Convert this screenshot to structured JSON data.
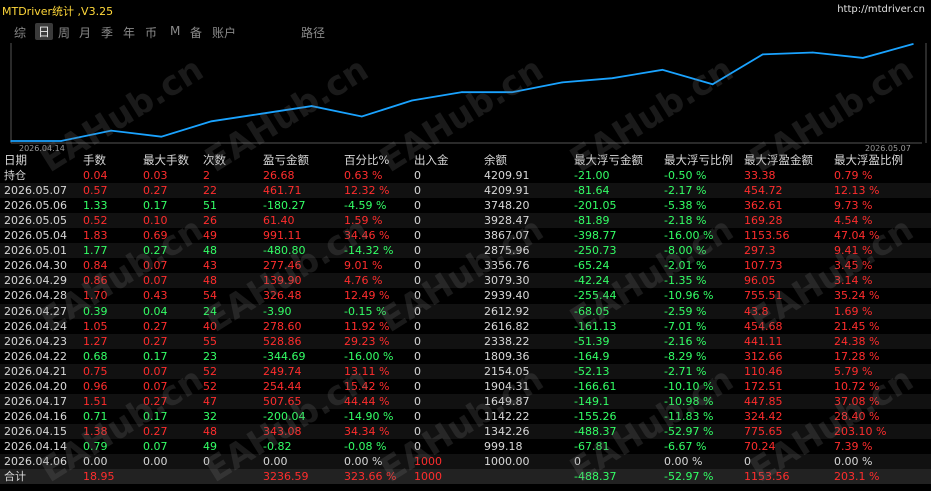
{
  "header": {
    "title": "MTDriver统计 ,V3.25",
    "url": "http://mtdriver.cn"
  },
  "tabs": [
    {
      "label": "综",
      "active": false
    },
    {
      "label": "日",
      "active": true
    },
    {
      "label": "周",
      "active": false
    },
    {
      "label": "月",
      "active": false
    },
    {
      "label": "季",
      "active": false
    },
    {
      "label": "年",
      "active": false
    },
    {
      "label": "币",
      "active": false
    },
    {
      "label": "M",
      "active": false
    },
    {
      "label": "备",
      "active": false
    },
    {
      "label": "账户",
      "active": false
    },
    {
      "label": "路径",
      "active": false
    }
  ],
  "chart_data": {
    "type": "line",
    "x_start_label": "2026.04.14",
    "x_end_label": "2026.05.07",
    "color": "#1aa3ff",
    "x": [
      "2026.04.06",
      "2026.04.14",
      "2026.04.15",
      "2026.04.16",
      "2026.04.17",
      "2026.04.20",
      "2026.04.21",
      "2026.04.22",
      "2026.04.23",
      "2026.04.24",
      "2026.04.27",
      "2026.04.28",
      "2026.04.29",
      "2026.04.30",
      "2026.05.01",
      "2026.05.04",
      "2026.05.05",
      "2026.05.06",
      "2026.05.07"
    ],
    "values": [
      1000.0,
      999.18,
      1342.26,
      1142.22,
      1649.87,
      1904.31,
      2154.05,
      1809.36,
      2338.22,
      2616.82,
      2612.92,
      2939.4,
      3079.3,
      3356.76,
      2875.96,
      3867.07,
      3928.47,
      3748.2,
      4209.91
    ]
  },
  "table": {
    "headers": [
      "日期",
      "手数",
      "最大手数",
      "次数",
      "盈亏金额",
      "百分比%",
      "出入金",
      "余额",
      "最大浮亏金额",
      "最大浮亏比例",
      "最大浮盈金额",
      "最大浮盈比例"
    ],
    "rows": [
      {
        "c": [
          "持仓",
          "0.04",
          "0.03",
          "2",
          "26.68",
          "0.63 %",
          "0",
          "4209.91",
          "-21.00",
          "-0.50 %",
          "33.38",
          "0.79 %"
        ],
        "k": [
          "w",
          "r",
          "r",
          "r",
          "r",
          "r",
          "w",
          "w",
          "g",
          "g",
          "r",
          "r"
        ]
      },
      {
        "c": [
          "2026.05.07",
          "0.57",
          "0.27",
          "22",
          "461.71",
          "12.32 %",
          "0",
          "4209.91",
          "-81.64",
          "-2.17 %",
          "454.72",
          "12.13 %"
        ],
        "k": [
          "w",
          "r",
          "r",
          "r",
          "r",
          "r",
          "w",
          "w",
          "g",
          "g",
          "r",
          "r"
        ]
      },
      {
        "c": [
          "2026.05.06",
          "1.33",
          "0.17",
          "51",
          "-180.27",
          "-4.59 %",
          "0",
          "3748.20",
          "-201.05",
          "-5.38 %",
          "362.61",
          "9.73 %"
        ],
        "k": [
          "w",
          "g",
          "g",
          "g",
          "g",
          "g",
          "w",
          "w",
          "g",
          "g",
          "r",
          "r"
        ]
      },
      {
        "c": [
          "2026.05.05",
          "0.52",
          "0.10",
          "26",
          "61.40",
          "1.59 %",
          "0",
          "3928.47",
          "-81.89",
          "-2.18 %",
          "169.28",
          "4.54 %"
        ],
        "k": [
          "w",
          "r",
          "r",
          "r",
          "r",
          "r",
          "w",
          "w",
          "g",
          "g",
          "r",
          "r"
        ]
      },
      {
        "c": [
          "2026.05.04",
          "1.83",
          "0.69",
          "49",
          "991.11",
          "34.46 %",
          "0",
          "3867.07",
          "-398.77",
          "-16.00 %",
          "1153.56",
          "47.04 %"
        ],
        "k": [
          "w",
          "r",
          "r",
          "r",
          "r",
          "r",
          "w",
          "w",
          "g",
          "g",
          "r",
          "r"
        ]
      },
      {
        "c": [
          "2026.05.01",
          "1.77",
          "0.27",
          "48",
          "-480.80",
          "-14.32 %",
          "0",
          "2875.96",
          "-250.73",
          "-8.00 %",
          "297.3",
          "9.41 %"
        ],
        "k": [
          "w",
          "g",
          "g",
          "g",
          "g",
          "g",
          "w",
          "w",
          "g",
          "g",
          "r",
          "r"
        ]
      },
      {
        "c": [
          "2026.04.30",
          "0.84",
          "0.07",
          "43",
          "277.46",
          "9.01 %",
          "0",
          "3356.76",
          "-65.24",
          "-2.01 %",
          "107.73",
          "3.45 %"
        ],
        "k": [
          "w",
          "r",
          "r",
          "r",
          "r",
          "r",
          "w",
          "w",
          "g",
          "g",
          "r",
          "r"
        ]
      },
      {
        "c": [
          "2026.04.29",
          "0.86",
          "0.07",
          "48",
          "139.90",
          "4.76 %",
          "0",
          "3079.30",
          "-42.24",
          "-1.35 %",
          "96.05",
          "3.14 %"
        ],
        "k": [
          "w",
          "r",
          "r",
          "r",
          "r",
          "r",
          "w",
          "w",
          "g",
          "g",
          "r",
          "r"
        ]
      },
      {
        "c": [
          "2026.04.28",
          "1.70",
          "0.43",
          "54",
          "326.48",
          "12.49 %",
          "0",
          "2939.40",
          "-255.44",
          "-10.96 %",
          "755.51",
          "35.24 %"
        ],
        "k": [
          "w",
          "r",
          "r",
          "r",
          "r",
          "r",
          "w",
          "w",
          "g",
          "g",
          "r",
          "r"
        ]
      },
      {
        "c": [
          "2026.04.27",
          "0.39",
          "0.04",
          "24",
          "-3.90",
          "-0.15 %",
          "0",
          "2612.92",
          "-68.05",
          "-2.59 %",
          "43.8",
          "1.69 %"
        ],
        "k": [
          "w",
          "g",
          "g",
          "g",
          "g",
          "g",
          "w",
          "w",
          "g",
          "g",
          "r",
          "r"
        ]
      },
      {
        "c": [
          "2026.04.24",
          "1.05",
          "0.27",
          "40",
          "278.60",
          "11.92 %",
          "0",
          "2616.82",
          "-161.13",
          "-7.01 %",
          "454.68",
          "21.45 %"
        ],
        "k": [
          "w",
          "r",
          "r",
          "r",
          "r",
          "r",
          "w",
          "w",
          "g",
          "g",
          "r",
          "r"
        ]
      },
      {
        "c": [
          "2026.04.23",
          "1.27",
          "0.27",
          "55",
          "528.86",
          "29.23 %",
          "0",
          "2338.22",
          "-51.39",
          "-2.16 %",
          "441.11",
          "24.38 %"
        ],
        "k": [
          "w",
          "r",
          "r",
          "r",
          "r",
          "r",
          "w",
          "w",
          "g",
          "g",
          "r",
          "r"
        ]
      },
      {
        "c": [
          "2026.04.22",
          "0.68",
          "0.17",
          "23",
          "-344.69",
          "-16.00 %",
          "0",
          "1809.36",
          "-164.9",
          "-8.29 %",
          "312.66",
          "17.28 %"
        ],
        "k": [
          "w",
          "g",
          "g",
          "g",
          "g",
          "g",
          "w",
          "w",
          "g",
          "g",
          "r",
          "r"
        ]
      },
      {
        "c": [
          "2026.04.21",
          "0.75",
          "0.07",
          "52",
          "249.74",
          "13.11 %",
          "0",
          "2154.05",
          "-52.13",
          "-2.71 %",
          "110.46",
          "5.79 %"
        ],
        "k": [
          "w",
          "r",
          "r",
          "r",
          "r",
          "r",
          "w",
          "w",
          "g",
          "g",
          "r",
          "r"
        ]
      },
      {
        "c": [
          "2026.04.20",
          "0.96",
          "0.07",
          "52",
          "254.44",
          "15.42 %",
          "0",
          "1904.31",
          "-166.61",
          "-10.10 %",
          "172.51",
          "10.72 %"
        ],
        "k": [
          "w",
          "r",
          "r",
          "r",
          "r",
          "r",
          "w",
          "w",
          "g",
          "g",
          "r",
          "r"
        ]
      },
      {
        "c": [
          "2026.04.17",
          "1.51",
          "0.27",
          "47",
          "507.65",
          "44.44 %",
          "0",
          "1649.87",
          "-149.1",
          "-10.98 %",
          "447.85",
          "37.08 %"
        ],
        "k": [
          "w",
          "r",
          "r",
          "r",
          "r",
          "r",
          "w",
          "w",
          "g",
          "g",
          "r",
          "r"
        ]
      },
      {
        "c": [
          "2026.04.16",
          "0.71",
          "0.17",
          "32",
          "-200.04",
          "-14.90 %",
          "0",
          "1142.22",
          "-155.26",
          "-11.83 %",
          "324.42",
          "28.40 %"
        ],
        "k": [
          "w",
          "g",
          "g",
          "g",
          "g",
          "g",
          "w",
          "w",
          "g",
          "g",
          "r",
          "r"
        ]
      },
      {
        "c": [
          "2026.04.15",
          "1.38",
          "0.27",
          "48",
          "343.08",
          "34.34 %",
          "0",
          "1342.26",
          "-488.37",
          "-52.97 %",
          "775.65",
          "203.10 %"
        ],
        "k": [
          "w",
          "r",
          "r",
          "r",
          "r",
          "r",
          "w",
          "w",
          "g",
          "g",
          "r",
          "r"
        ]
      },
      {
        "c": [
          "2026.04.14",
          "0.79",
          "0.07",
          "49",
          "-0.82",
          "-0.08 %",
          "0",
          "999.18",
          "-67.81",
          "-6.67 %",
          "70.24",
          "7.39 %"
        ],
        "k": [
          "w",
          "g",
          "g",
          "g",
          "g",
          "g",
          "w",
          "w",
          "g",
          "g",
          "r",
          "r"
        ]
      },
      {
        "c": [
          "2026.04.06",
          "0.00",
          "0.00",
          "0",
          "0.00",
          "0.00 %",
          "1000",
          "1000.00",
          "0",
          "0.00 %",
          "0",
          "0.00 %"
        ],
        "k": [
          "w",
          "w",
          "w",
          "w",
          "w",
          "w",
          "r",
          "w",
          "w",
          "w",
          "w",
          "w"
        ]
      }
    ],
    "total": {
      "c": [
        "合计",
        "18.95",
        "",
        "",
        "3236.59",
        "323.66 %",
        "1000",
        "",
        "-488.37",
        "-52.97 %",
        "1153.56",
        "203.1 %"
      ],
      "k": [
        "w",
        "r",
        "w",
        "w",
        "r",
        "r",
        "r",
        "w",
        "g",
        "g",
        "r",
        "r"
      ]
    }
  },
  "watermark": "EAHub.cn"
}
